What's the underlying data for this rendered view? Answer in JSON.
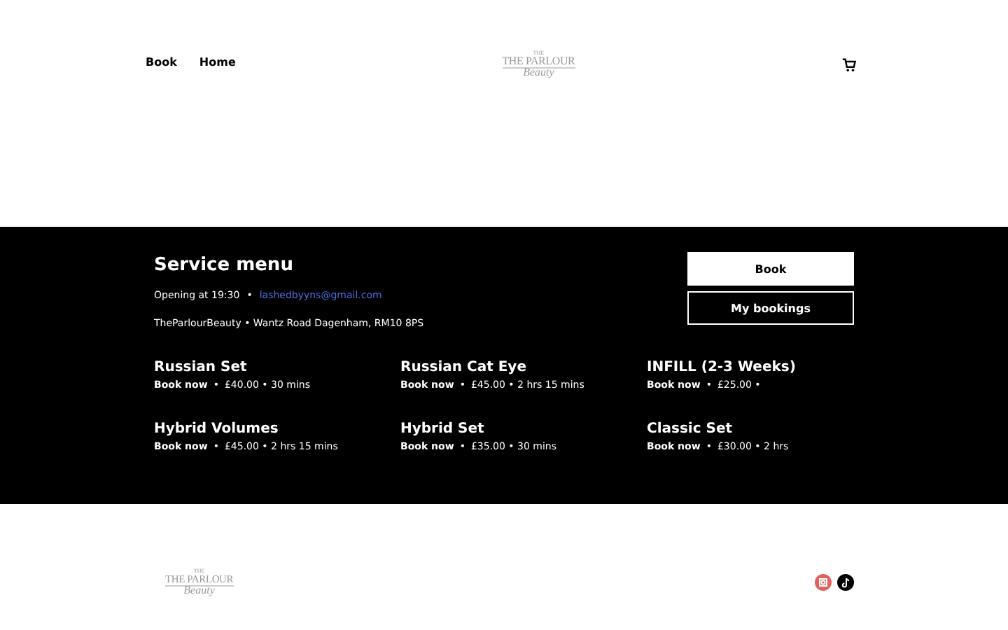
{
  "header": {
    "nav": [
      {
        "label": "Book"
      },
      {
        "label": "Home"
      }
    ],
    "logo": {
      "small": "THE",
      "main": "THE PARLOUR",
      "script": "Beauty"
    }
  },
  "service_menu": {
    "title": "Service menu",
    "opening": "Opening at 19:30",
    "separator": "•",
    "email": "lashedbyyns@gmail.com",
    "address": "TheParlourBeauty • Wantz Road Dagenham, RM10 8PS",
    "buttons": [
      {
        "label": "Book",
        "kind": "filled"
      },
      {
        "label": "My bookings",
        "kind": "outline"
      }
    ],
    "services": [
      {
        "name": "Russian Set",
        "action": "Book now",
        "separator": "•",
        "details": "£40.00 • 30 mins"
      },
      {
        "name": "Russian Cat Eye",
        "action": "Book now",
        "separator": "•",
        "details": "£45.00 • 2 hrs 15 mins"
      },
      {
        "name": "INFILL (2-3 Weeks)",
        "action": "Book now",
        "separator": "•",
        "details": "£25.00 •"
      },
      {
        "name": "Hybrid Volumes",
        "action": "Book now",
        "separator": "•",
        "details": "£45.00 • 2 hrs 15 mins"
      },
      {
        "name": "Hybrid Set",
        "action": "Book now",
        "separator": "•",
        "details": "£35.00 • 30 mins"
      },
      {
        "name": "Classic Set",
        "action": "Book now",
        "separator": "•",
        "details": "£30.00 • 2 hrs"
      }
    ]
  },
  "footer": {
    "logo": {
      "small": "THE",
      "main": "THE PARLOUR",
      "script": "Beauty"
    },
    "social": [
      {
        "kind": "instagram",
        "color": "#e0625e"
      },
      {
        "kind": "tiktok",
        "color": "#000000"
      }
    ]
  }
}
